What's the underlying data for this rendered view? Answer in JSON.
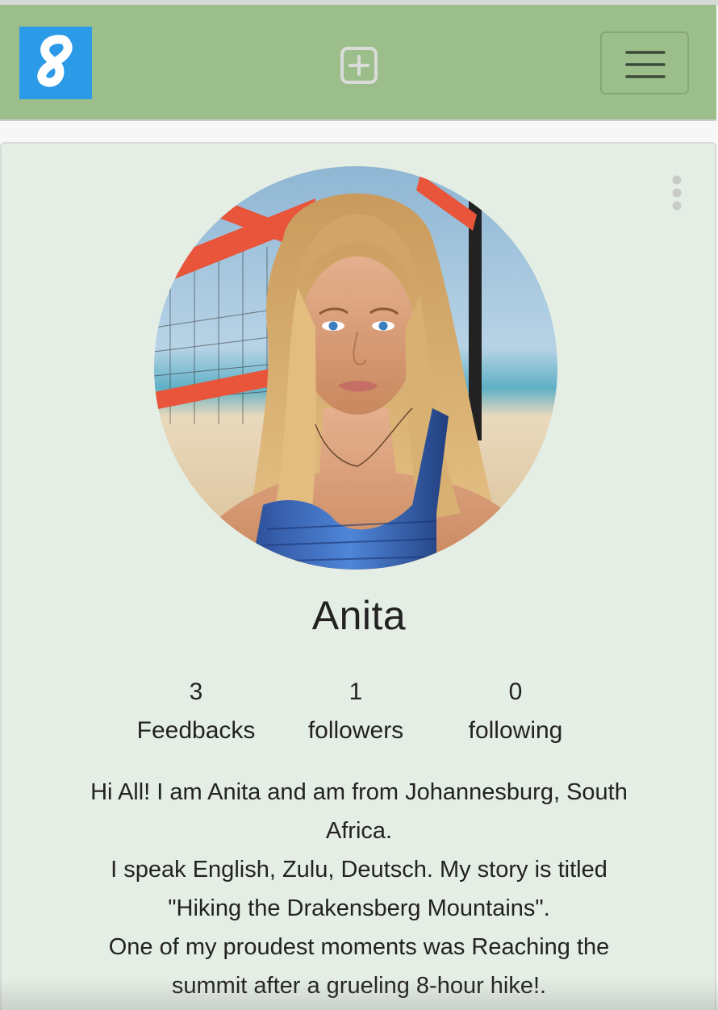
{
  "navbar": {
    "logo_letter": "8",
    "logo_color": "#2b9be8",
    "bg_color": "#9cbe8a",
    "add_icon": "plus-square-icon",
    "menu_icon": "hamburger-icon"
  },
  "profile": {
    "name": "Anita",
    "options_icon": "kebab-vertical-icon",
    "stats": [
      {
        "value": "3",
        "label": "Feedbacks"
      },
      {
        "value": "1",
        "label": "followers"
      },
      {
        "value": "0",
        "label": "following"
      }
    ],
    "bio_lines": [
      "Hi All! I am Anita and am from Johannesburg, South",
      "Africa.",
      "I speak English, Zulu, Deutsch. My story is titled",
      "\"Hiking the Drakensberg Mountains\".",
      "One of my proudest moments was Reaching the",
      "summit after a grueling 8-hour hike!."
    ],
    "card_bg": "#e5eee5"
  }
}
